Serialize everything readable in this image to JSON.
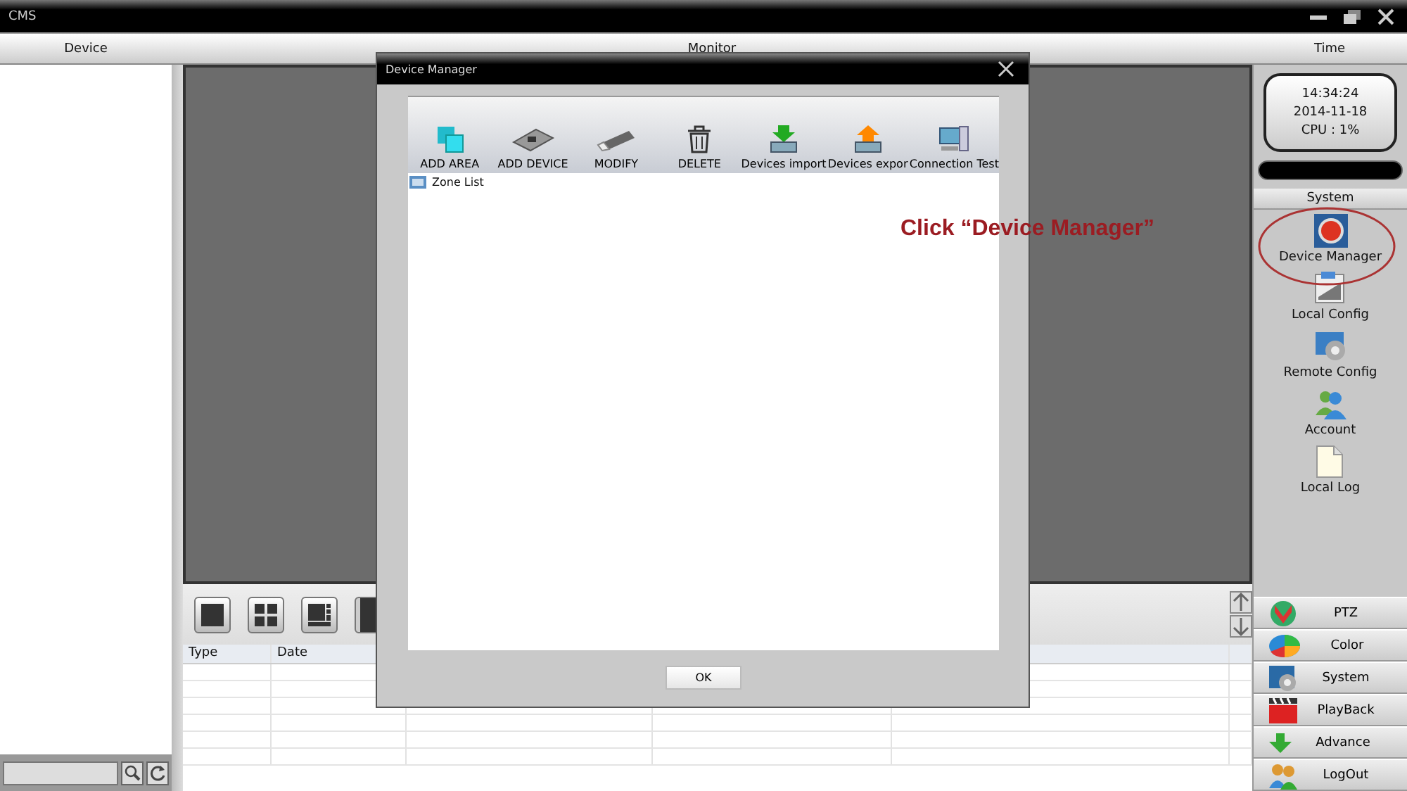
{
  "window": {
    "title": "CMS"
  },
  "header": {
    "device": "Device",
    "monitor": "Monitor",
    "time": "Time"
  },
  "clock": {
    "time": "14:34:24",
    "date": "2014-11-18",
    "cpu": "CPU : 1%"
  },
  "system_panel": {
    "title": "System",
    "items": [
      {
        "label": "Device Manager"
      },
      {
        "label": "Local Config"
      },
      {
        "label": "Remote Config"
      },
      {
        "label": "Account"
      },
      {
        "label": "Local Log"
      }
    ]
  },
  "bottom_menu": [
    {
      "label": "PTZ"
    },
    {
      "label": "Color"
    },
    {
      "label": "System"
    },
    {
      "label": "PlayBack"
    },
    {
      "label": "Advance"
    },
    {
      "label": "LogOut"
    }
  ],
  "annotation": "Click “Device Manager”",
  "event_table": {
    "columns": [
      "Type",
      "Date"
    ]
  },
  "dialog": {
    "title": "Device Manager",
    "toolbar": [
      {
        "label": "ADD AREA"
      },
      {
        "label": "ADD DEVICE"
      },
      {
        "label": "MODIFY"
      },
      {
        "label": "DELETE"
      },
      {
        "label": "Devices import"
      },
      {
        "label": "Devices expor"
      },
      {
        "label": "Connection Test"
      }
    ],
    "tree": [
      {
        "label": "Zone List"
      }
    ],
    "ok": "OK"
  }
}
